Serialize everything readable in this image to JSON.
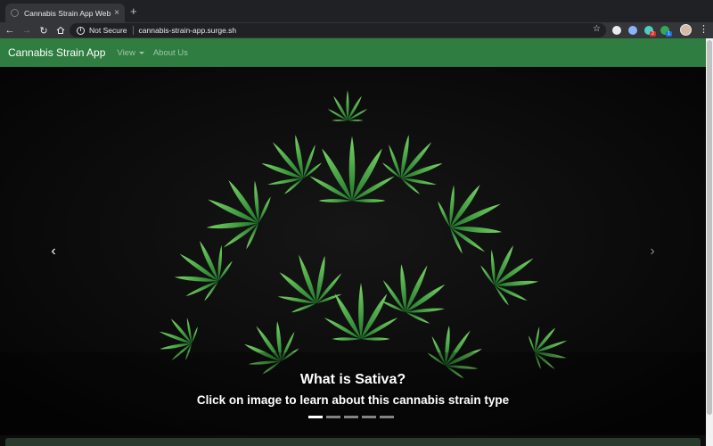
{
  "browser": {
    "tab_title": "Cannabis Strain App Website",
    "tab_close": "×",
    "new_tab": "+",
    "security_label": "Not Secure",
    "url": "cannabis-strain-app.surge.sh",
    "extension_badges": [
      "2",
      "1"
    ]
  },
  "navbar": {
    "brand": "Cannabis Strain App",
    "links": [
      {
        "label": "View",
        "dropdown": true
      },
      {
        "label": "About Us",
        "dropdown": false
      }
    ],
    "color": "#2f7d40"
  },
  "carousel": {
    "caption_title": "What is Sativa?",
    "caption_subtitle": "Click on image to learn about this cannabis strain type",
    "prev_label": "‹",
    "next_label": "›",
    "slide_count": 5,
    "active_slide": 1,
    "image_subject": "cannabis-plant-photo"
  }
}
